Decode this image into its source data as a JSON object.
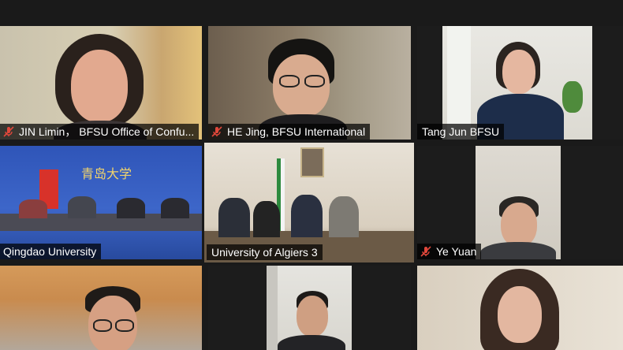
{
  "tiles": [
    {
      "name": "JIN Limin， BFSU Office of Confu...",
      "muted": true
    },
    {
      "name": "HE Jing, BFSU International",
      "muted": true
    },
    {
      "name": "Tang Jun BFSU",
      "muted": false
    },
    {
      "name": "Qingdao University",
      "muted": false
    },
    {
      "name": "University of Algiers 3",
      "muted": false,
      "active": true
    },
    {
      "name": "Ye Yuan",
      "muted": true
    },
    {
      "name": "",
      "muted": false
    },
    {
      "name": "",
      "muted": false
    },
    {
      "name": "",
      "muted": false
    }
  ],
  "banner_text": "青岛大学",
  "colors": {
    "active_border": "#b7e65a",
    "muted_mic": "#e0473b",
    "label_bg": "#000000"
  }
}
